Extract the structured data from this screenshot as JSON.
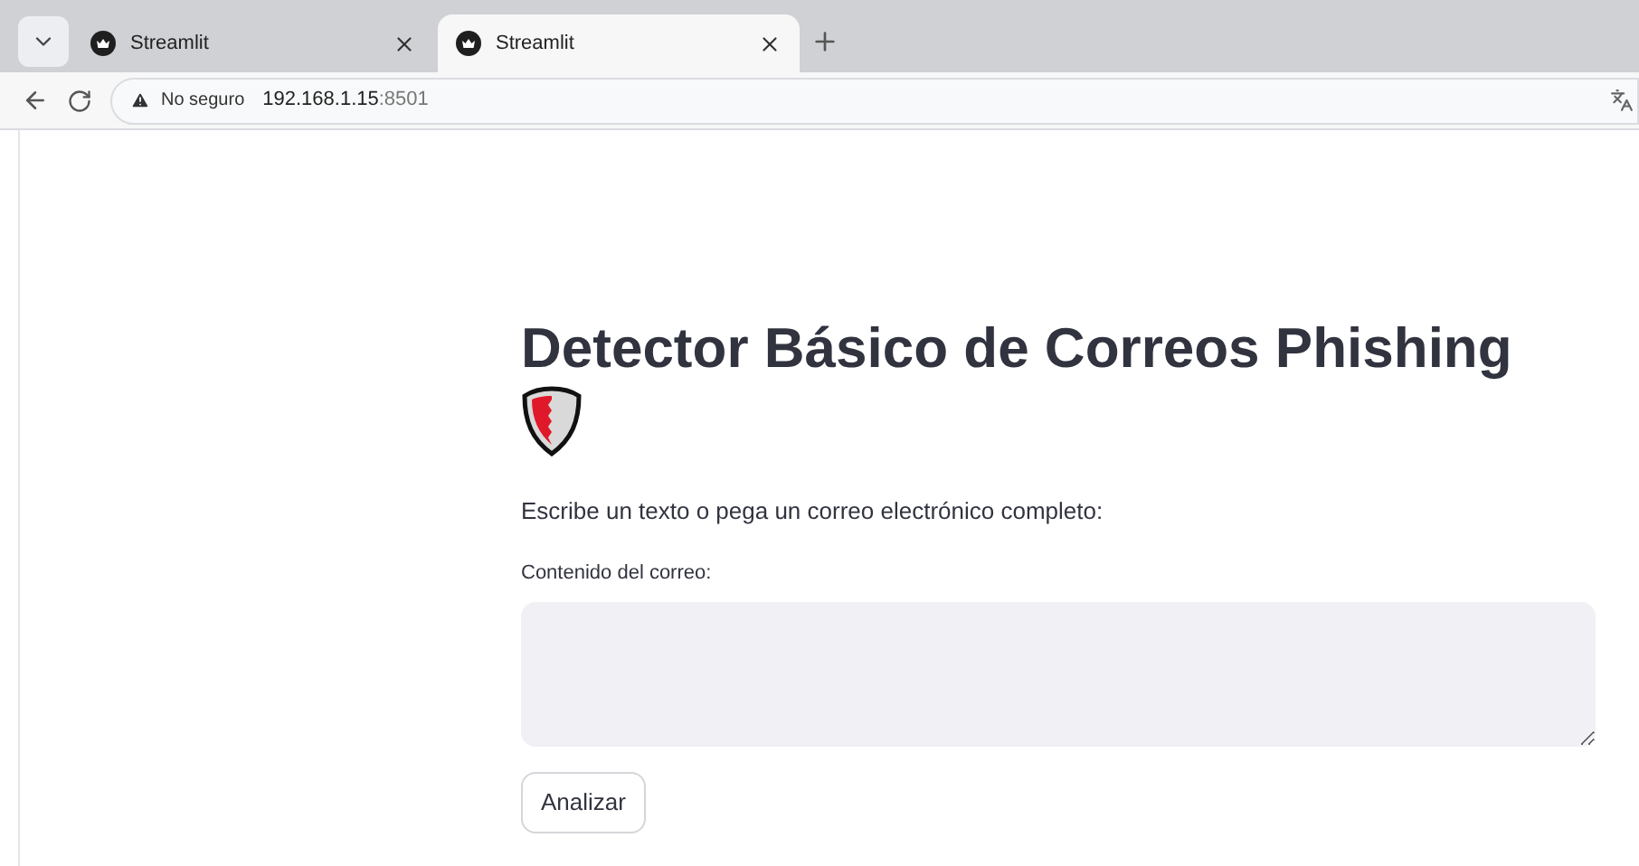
{
  "browser": {
    "tabs": [
      {
        "label": "Streamlit",
        "selected": false
      },
      {
        "label": "Streamlit",
        "selected": true
      }
    ],
    "security_label": "No seguro",
    "url_host": "192.168.1.15",
    "url_port": ":8501"
  },
  "page": {
    "title": "Detector Básico de Correos Phishing",
    "intro": "Escribe un texto o pega un correo electrónico completo:",
    "field_label": "Contenido del correo:",
    "button": "Analizar"
  }
}
